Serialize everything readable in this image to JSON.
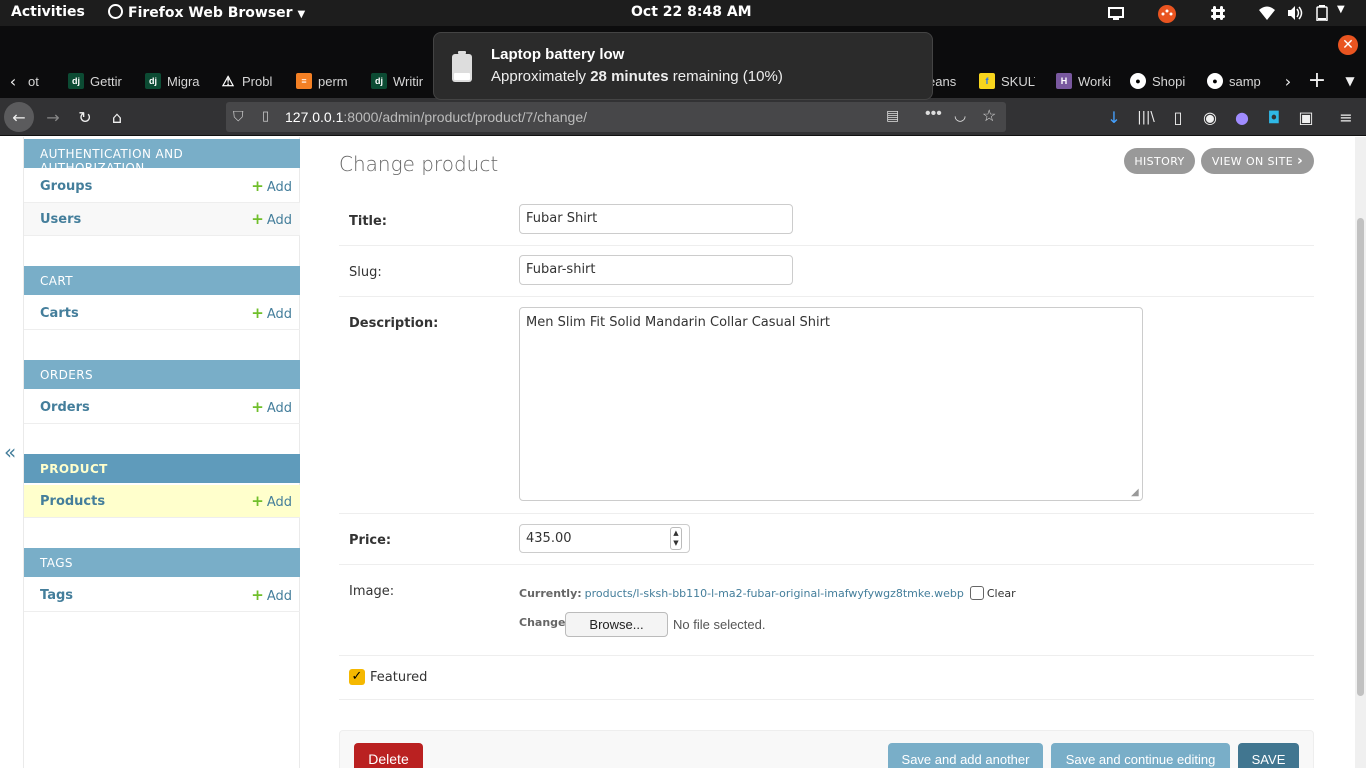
{
  "topbar": {
    "activities": "Activities",
    "app_menu": "Firefox Web Browser",
    "clock": "Oct 22   8:48 AM"
  },
  "tabs": [
    {
      "label": "ot",
      "favicon": "page"
    },
    {
      "label": "Gettir",
      "favicon": "dj"
    },
    {
      "label": "Migra",
      "favicon": "dj"
    },
    {
      "label": "Probl",
      "favicon": "warning"
    },
    {
      "label": "perm",
      "favicon": "stackoverflow"
    },
    {
      "label": "Writir",
      "favicon": "dj"
    },
    {
      "label": "eans",
      "favicon": "page"
    },
    {
      "label": "SKULT",
      "favicon": "flipkart"
    },
    {
      "label": "Worki",
      "favicon": "heroku"
    },
    {
      "label": "Shopi",
      "favicon": "github"
    },
    {
      "label": "samp",
      "favicon": "github"
    }
  ],
  "browser": {
    "url_host": "127.0.0.1",
    "url_path": ":8000/admin/product/product/7/change/"
  },
  "notification": {
    "title": "Laptop battery low",
    "body_prefix": "Approximately ",
    "body_bold": "28 minutes",
    "body_suffix": " remaining (10%)"
  },
  "sidebar": {
    "collapse": "«",
    "add_label": "Add",
    "modules": [
      {
        "header": "AUTHENTICATION AND AUTHORIZATION",
        "rows": [
          "Groups",
          "Users"
        ]
      },
      {
        "header": "CART",
        "rows": [
          "Carts"
        ]
      },
      {
        "header": "ORDERS",
        "rows": [
          "Orders"
        ]
      },
      {
        "header": "PRODUCT",
        "rows": [
          "Products"
        ]
      },
      {
        "header": "TAGS",
        "rows": [
          "Tags"
        ]
      }
    ]
  },
  "content": {
    "heading": "Change product",
    "history_btn": "HISTORY",
    "view_on_site_btn": "VIEW ON SITE",
    "title_label": "Title:",
    "title_value": "Fubar Shirt",
    "slug_label": "Slug:",
    "slug_value": "Fubar-shirt",
    "description_label": "Description:",
    "description_value": "Men Slim Fit Solid Mandarin Collar Casual Shirt",
    "price_label": "Price:",
    "price_value": "435.00",
    "image_label": "Image:",
    "currently_label": "Currently:",
    "image_file": "products/l-sksh-bb110-l-ma2-fubar-original-imafwyfywgz8tmke.webp",
    "clear_label": "Clear",
    "change_label": "Change:",
    "browse_btn": "Browse...",
    "no_file": "No file selected.",
    "featured_label": "Featured",
    "featured_checked": true,
    "delete_btn": "Delete",
    "save_add_btn": "Save and add another",
    "save_continue_btn": "Save and continue editing",
    "save_btn": "SAVE"
  },
  "colors": {
    "module_header": "#79aec8",
    "link": "#447e9b",
    "add_plus": "#70bf2b",
    "active_row": "#ffffcc",
    "delete": "#ba2121",
    "save_default": "#417690",
    "save_secondary": "#79aec8"
  }
}
